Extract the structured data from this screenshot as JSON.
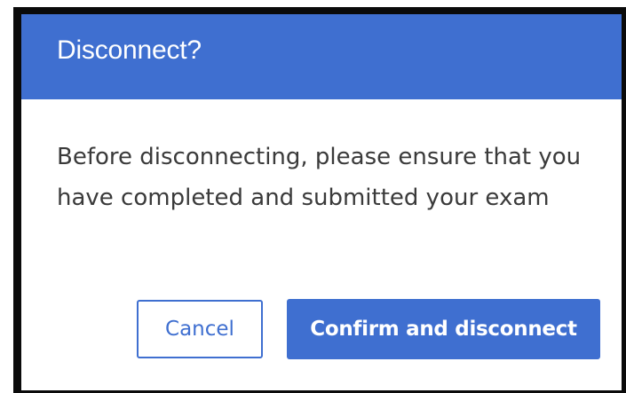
{
  "dialog": {
    "title": "Disconnect?",
    "message": "Before disconnecting, please ensure that you have completed and submitted your exam",
    "cancel_label": "Cancel",
    "confirm_label": "Confirm and disconnect"
  },
  "colors": {
    "accent": "#3f6fd0",
    "header_text": "#ffffff",
    "body_text": "#3a3a3a",
    "frame": "#0a0a0a"
  }
}
